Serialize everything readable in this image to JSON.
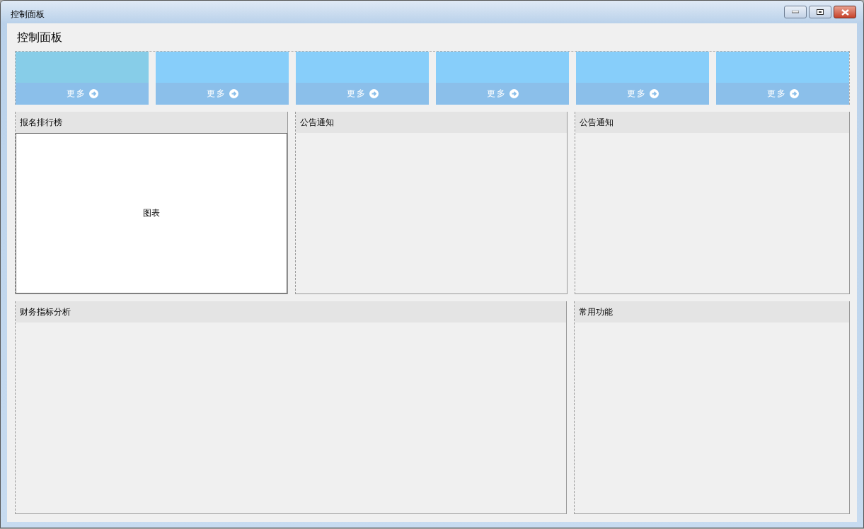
{
  "window": {
    "title": "控制面板"
  },
  "page_title": "控制面板",
  "tiles": [
    {
      "color": "#87cde8",
      "link": "更多"
    },
    {
      "color": "#87cefa",
      "link": "更多"
    },
    {
      "color": "#87cefa",
      "link": "更多"
    },
    {
      "color": "#87cefa",
      "link": "更多"
    },
    {
      "color": "#87cefa",
      "link": "更多"
    },
    {
      "color": "#87cefa",
      "link": "更多"
    }
  ],
  "panels_top": [
    {
      "title": "报名排行榜",
      "chart": {
        "placeholder": "图表"
      }
    },
    {
      "title": "公告通知"
    },
    {
      "title": "公告通知"
    }
  ],
  "panels_bottom": [
    {
      "title": "财务指标分析"
    },
    {
      "title": "常用功能"
    }
  ]
}
